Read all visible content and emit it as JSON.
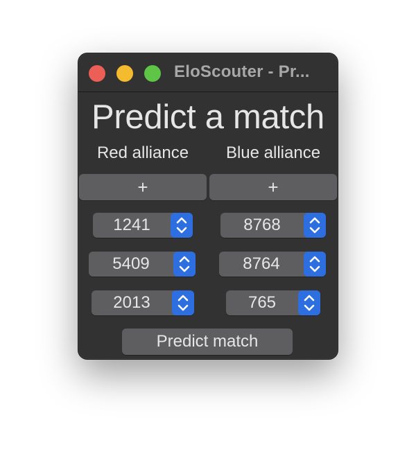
{
  "window": {
    "title": "EloScouter - Pr..."
  },
  "main": {
    "heading": "Predict a match",
    "red_label": "Red alliance",
    "blue_label": "Blue alliance",
    "add_label": "+",
    "predict_label": "Predict match"
  },
  "red_teams": [
    "1241",
    "5409",
    "2013"
  ],
  "blue_teams": [
    "8768",
    "8764",
    "765"
  ],
  "colors": {
    "window_bg": "#323232",
    "control_bg": "#5e5e60",
    "stepper_accent": "#2d6fe0",
    "close": "#ec5f57",
    "minimize": "#f4bb2e",
    "zoom": "#5fc546"
  },
  "icons": {
    "stepper": "chevron-up-down-icon"
  }
}
